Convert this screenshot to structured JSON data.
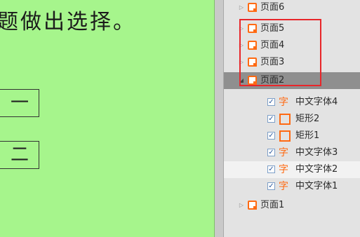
{
  "canvas": {
    "heading": "题做出选择。",
    "options": [
      "一",
      "二"
    ]
  },
  "layers": {
    "pages": [
      {
        "label": "页面6",
        "expanded": false
      },
      {
        "label": "页面5",
        "expanded": false
      },
      {
        "label": "页面4",
        "expanded": false
      },
      {
        "label": "页面3",
        "expanded": false
      },
      {
        "label": "页面2",
        "expanded": true,
        "selected": true
      },
      {
        "label": "页面1",
        "expanded": false
      }
    ],
    "children": [
      {
        "label": "中文字体4",
        "type": "text-icon",
        "icon_glyph": "字",
        "checked": true
      },
      {
        "label": "矩形2",
        "type": "rect-icon",
        "checked": true
      },
      {
        "label": "矩形1",
        "type": "rect-icon",
        "checked": true
      },
      {
        "label": "中文字体3",
        "type": "text-icon",
        "icon_glyph": "字",
        "checked": true
      },
      {
        "label": "中文字体2",
        "type": "text-icon",
        "icon_glyph": "字",
        "checked": true,
        "hover": true
      },
      {
        "label": "中文字体1",
        "type": "text-icon",
        "icon_glyph": "字",
        "checked": true
      }
    ],
    "check_glyph": "✓",
    "accent_color": "#ff6a13",
    "highlight_color": "#e8262a"
  }
}
